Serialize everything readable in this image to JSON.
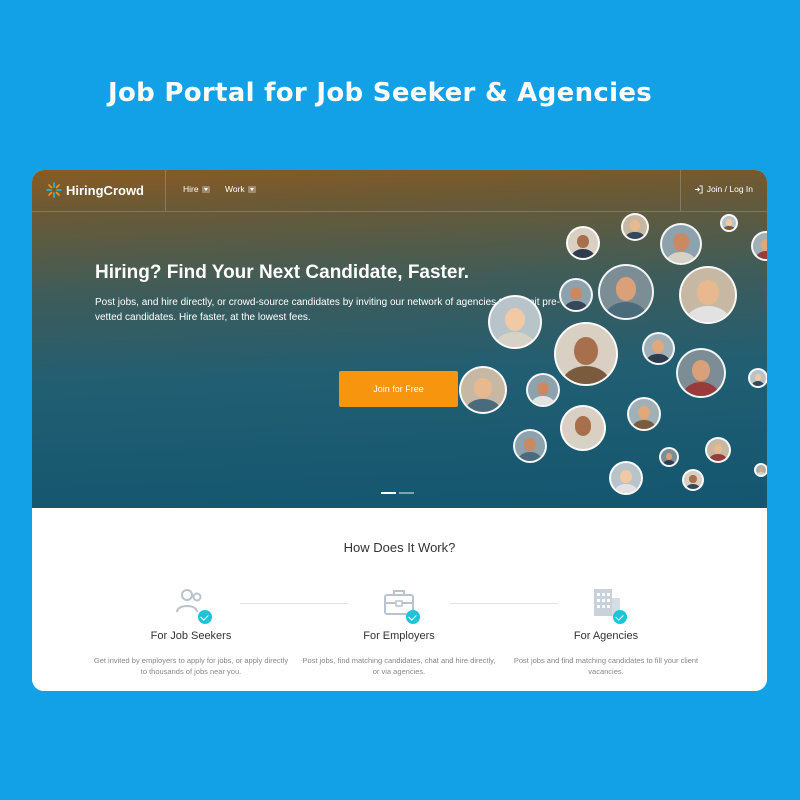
{
  "banner": {
    "title": "Job Portal for Job Seeker & Agencies"
  },
  "navbar": {
    "logo_text": "HiringCrowd",
    "items": [
      {
        "label": "Hire"
      },
      {
        "label": "Work"
      }
    ],
    "login_label": "Join / Log In"
  },
  "hero": {
    "headline": "Hiring? Find Your Next Candidate, Faster.",
    "subtext": "Post jobs, and hire directly, or crowd-source candidates by inviting our network of agencies to submit pre-vetted candidates. Hire faster, at the lowest fees.",
    "cta_label": "Join for Free",
    "slides": 2,
    "active_slide": 1
  },
  "how_it_works": {
    "title": "How Does It Work?",
    "steps": [
      {
        "icon": "users-icon",
        "title": "For Job Seekers",
        "desc": "Get invited by employers to apply for jobs, or apply directly to thousands of jobs near you."
      },
      {
        "icon": "briefcase-icon",
        "title": "For Employers",
        "desc": "Post jobs, find matching candidates, chat and hire directly, or via agencies."
      },
      {
        "icon": "building-icon",
        "title": "For Agencies",
        "desc": "Post jobs and find matching candidates to fill your client vacancies."
      }
    ]
  },
  "colors": {
    "background": "#12a0e6",
    "cta": "#f7950f",
    "check": "#19c6d8"
  }
}
